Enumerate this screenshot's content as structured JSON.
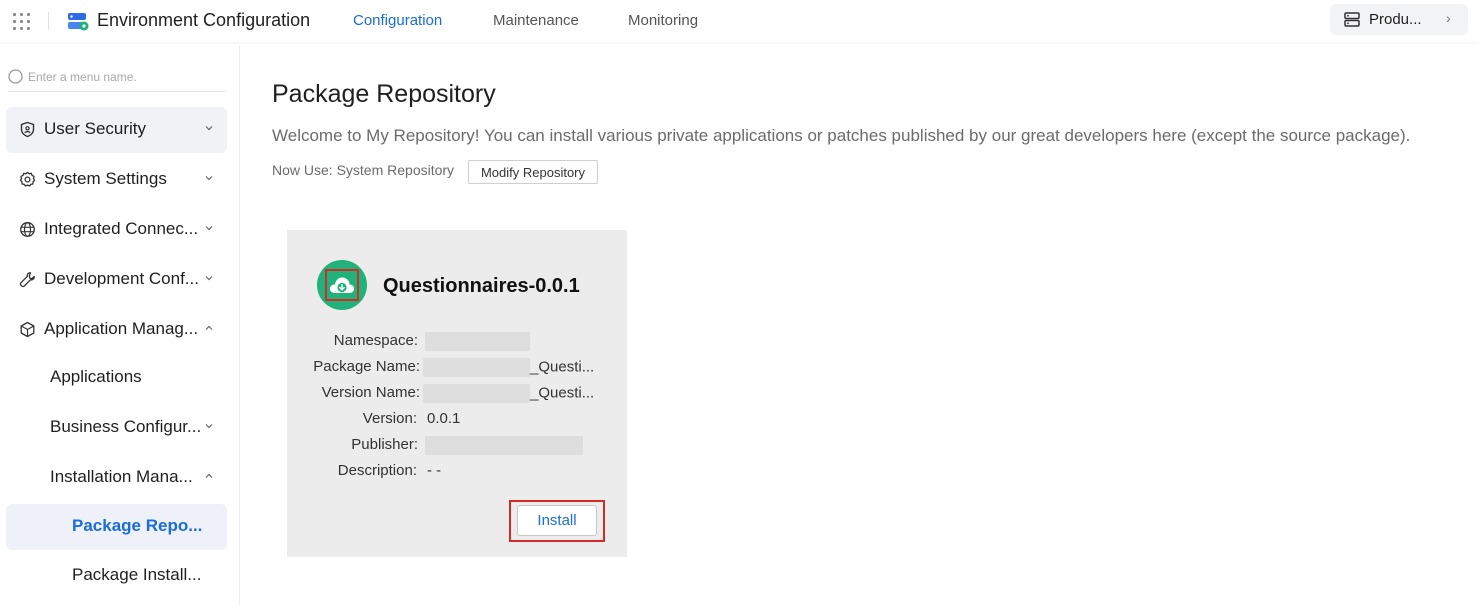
{
  "header": {
    "app_title": "Environment Configuration",
    "tabs": [
      {
        "label": "Configuration",
        "active": true
      },
      {
        "label": "Maintenance",
        "active": false
      },
      {
        "label": "Monitoring",
        "active": false
      }
    ],
    "product_switch": {
      "label": "Produ...",
      "icon": "server-icon"
    }
  },
  "sidebar": {
    "search_placeholder": "Enter a menu name.",
    "items": [
      {
        "label": "User Security",
        "icon": "shield-icon",
        "expanded": false
      },
      {
        "label": "System Settings",
        "icon": "gear-icon",
        "expanded": false
      },
      {
        "label": "Integrated Connec...",
        "icon": "globe-icon",
        "expanded": false
      },
      {
        "label": "Development Conf...",
        "icon": "wrench-icon",
        "expanded": false
      },
      {
        "label": "Application Manag...",
        "icon": "cube-icon",
        "expanded": true
      },
      {
        "label": "Applications"
      },
      {
        "label": "Business Configur...",
        "expanded": false
      },
      {
        "label": "Installation Mana...",
        "expanded": true
      },
      {
        "label": "Package Repo...",
        "selected": true
      },
      {
        "label": "Package Install..."
      }
    ]
  },
  "main": {
    "title": "Package Repository",
    "welcome": "Welcome to My Repository! You can install various private applications or patches published by our great developers here (except the source package).",
    "now_use": "Now Use: System Repository",
    "modify_button": "Modify Repository",
    "package": {
      "name": "Questionnaires-0.0.1",
      "icon": "cloud-download-icon",
      "fields": {
        "namespace_label": "Namespace:",
        "package_name_label": "Package Name:",
        "package_name_value": "_Questi...",
        "version_name_label": "Version Name:",
        "version_name_value": "_Questi...",
        "version_label": "Version:",
        "version_value": "0.0.1",
        "publisher_label": "Publisher:",
        "description_label": "Description:",
        "description_value": "- -"
      },
      "install_button": "Install"
    }
  },
  "colors": {
    "accent": "#1a6cd9",
    "package_icon": "#20b27a",
    "highlight_box": "#d42a2a",
    "card_bg": "#ececec"
  }
}
